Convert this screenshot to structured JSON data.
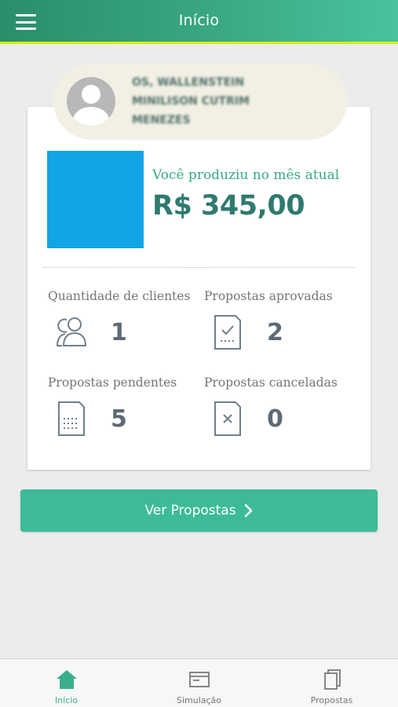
{
  "header": {
    "title": "Início",
    "menu_icon": "hamburger-menu-icon"
  },
  "profile": {
    "name": "OS, WALLENSTEIN MINILISON CUTRIM MENEZES"
  },
  "production": {
    "label": "Você produziu no mês atual",
    "value": "R$ 345,00",
    "block_color": "#13a4e6"
  },
  "stats": [
    {
      "label": "Quantidade de clientes",
      "value": "1",
      "icon": "users-icon"
    },
    {
      "label": "Propostas aprovadas",
      "value": "2",
      "icon": "approved-document-icon"
    },
    {
      "label": "Propostas pendentes",
      "value": "5",
      "icon": "pending-document-icon"
    },
    {
      "label": "Propostas canceladas",
      "value": "0",
      "icon": "cancelled-document-icon"
    }
  ],
  "cta": {
    "label": "Ver Propostas",
    "icon": "chevron-right-icon"
  },
  "bottom_nav": [
    {
      "label": "Início",
      "icon": "home-icon",
      "active": true
    },
    {
      "label": "Simulação",
      "icon": "simulation-window-icon",
      "active": false
    },
    {
      "label": "Propostas",
      "icon": "documents-icon",
      "active": false
    }
  ],
  "colors": {
    "accent": "#3dbb98",
    "header_underline": "#d6f000",
    "stat_text": "#5e6b75"
  }
}
